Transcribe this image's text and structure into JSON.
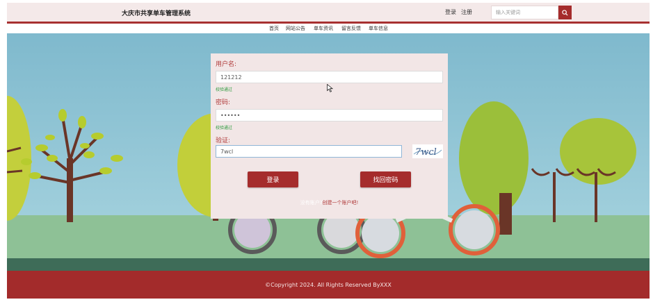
{
  "header": {
    "site_title": "大庆市共享单车管理系统",
    "login_label": "登录",
    "register_label": "注册",
    "search_placeholder": "输入关键词"
  },
  "nav": {
    "items": [
      {
        "label": "首页"
      },
      {
        "label": "网站公告"
      },
      {
        "label": "单车资讯"
      },
      {
        "label": "留言反馈"
      },
      {
        "label": "单车信息"
      }
    ]
  },
  "login_form": {
    "username_label": "用户名:",
    "username_value": "121212",
    "username_status": "校验通过",
    "password_label": "密码:",
    "password_value": "••••••",
    "password_status": "校验通过",
    "captcha_label": "验证:",
    "captcha_value": "7wcl",
    "captcha_image_text": "7wcl",
    "login_button": "登录",
    "forgot_button": "找回密码",
    "register_question": "没有账户?",
    "register_link": "创建一个账户吧!"
  },
  "footer": {
    "copyright": "©Copyright 2024. All Rights Reserved ByXXX"
  },
  "colors": {
    "brand_red": "#a52c2c",
    "header_bg": "#f4e9e9",
    "panel_bg": "#f2e6e6",
    "valid_green": "#2d9b3e",
    "sky_blue": "#8cc4d5"
  },
  "icons": {
    "search_button": "search-icon",
    "captcha": "captcha-image"
  }
}
